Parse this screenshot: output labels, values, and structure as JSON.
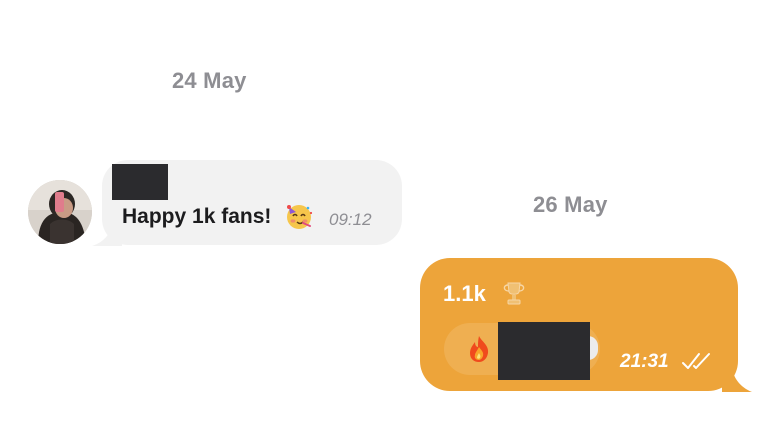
{
  "conversation": {
    "messages": [
      {
        "date_separator": "24 May",
        "direction": "incoming",
        "sender_name": "",
        "text": "Happy 1k fans!",
        "emoji": "partying-face",
        "time": "09:12"
      },
      {
        "date_separator": "26 May",
        "direction": "outgoing",
        "title": "1.1k",
        "title_emoji": "trophy",
        "reply_emoji": "fire",
        "reply_content": "",
        "time": "21:31",
        "status": "read"
      }
    ]
  },
  "colors": {
    "background": "#ffffff",
    "incoming_bubble": "#f2f2f2",
    "outgoing_bubble": "#eda43a",
    "date_text": "#8e8e93",
    "redaction": "#2b2b2e"
  }
}
